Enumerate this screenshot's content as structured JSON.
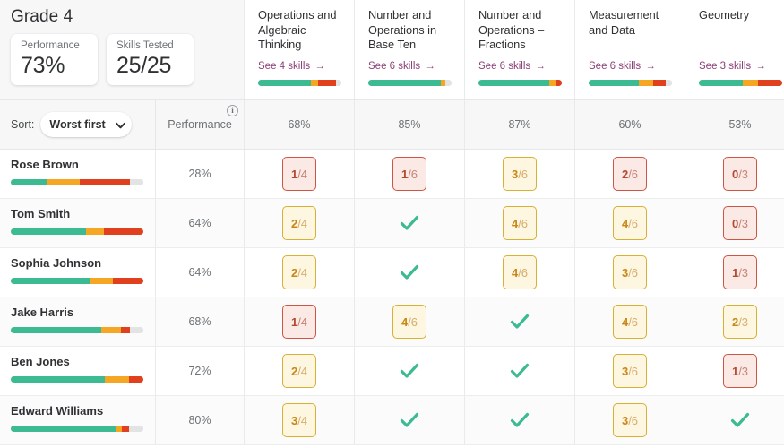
{
  "header": {
    "grade_title": "Grade 4",
    "cards": [
      {
        "label": "Performance",
        "value": "73%"
      },
      {
        "label": "Skills Tested",
        "value": "25/25"
      }
    ]
  },
  "sort": {
    "label": "Sort:",
    "value": "Worst first",
    "chevron_icon": "chevron-down-icon"
  },
  "performance_column": {
    "label": "Performance",
    "info_icon": "info-icon",
    "info_glyph": "i"
  },
  "colors": {
    "green": "#3cba92",
    "orange": "#f5a623",
    "red": "#e0401d",
    "grey": "#e2e3e4",
    "link": "#8c3f77",
    "check": "#3cba92"
  },
  "subjects": [
    {
      "title": "Operations and Algebraic Thinking",
      "link": "See 4 skills",
      "arrow": "→",
      "percent": "68%",
      "bar": {
        "green": 63,
        "orange": 9,
        "red": 22,
        "grey": 6
      }
    },
    {
      "title": "Number and Operations in Base Ten",
      "link": "See 6 skills",
      "arrow": "→",
      "percent": "85%",
      "bar": {
        "green": 87,
        "orange": 6,
        "red": 0,
        "grey": 7
      }
    },
    {
      "title": "Number and Operations – Fractions",
      "link": "See 6 skills",
      "arrow": "→",
      "percent": "87%",
      "bar": {
        "green": 85,
        "orange": 8,
        "red": 7,
        "grey": 0
      }
    },
    {
      "title": "Measurement and Data",
      "link": "See 6 skills",
      "arrow": "→",
      "percent": "60%",
      "bar": {
        "green": 60,
        "orange": 17,
        "red": 16,
        "grey": 7
      }
    },
    {
      "title": "Geometry",
      "link": "See 3 skills",
      "arrow": "→",
      "percent": "53%",
      "bar": {
        "green": 53,
        "orange": 18,
        "red": 29,
        "grey": 0
      }
    }
  ],
  "students": [
    {
      "name": "Rose Brown",
      "performance": "28%",
      "bar": {
        "green": 28,
        "orange": 24,
        "red": 38,
        "grey": 10
      },
      "scores": [
        {
          "type": "box",
          "level": "red",
          "num": "1",
          "den": "/4"
        },
        {
          "type": "box",
          "level": "red",
          "num": "1",
          "den": "/6"
        },
        {
          "type": "box",
          "level": "amber",
          "num": "3",
          "den": "/6"
        },
        {
          "type": "box",
          "level": "red",
          "num": "2",
          "den": "/6"
        },
        {
          "type": "box",
          "level": "red",
          "num": "0",
          "den": "/3"
        }
      ]
    },
    {
      "name": "Tom Smith",
      "performance": "64%",
      "bar": {
        "green": 57,
        "orange": 13,
        "red": 30,
        "grey": 0
      },
      "scores": [
        {
          "type": "box",
          "level": "amber",
          "num": "2",
          "den": "/4"
        },
        {
          "type": "check"
        },
        {
          "type": "box",
          "level": "amber",
          "num": "4",
          "den": "/6"
        },
        {
          "type": "box",
          "level": "amber",
          "num": "4",
          "den": "/6"
        },
        {
          "type": "box",
          "level": "red",
          "num": "0",
          "den": "/3"
        }
      ]
    },
    {
      "name": "Sophia Johnson",
      "performance": "64%",
      "bar": {
        "green": 60,
        "orange": 17,
        "red": 23,
        "grey": 0
      },
      "scores": [
        {
          "type": "box",
          "level": "amber",
          "num": "2",
          "den": "/4"
        },
        {
          "type": "check"
        },
        {
          "type": "box",
          "level": "amber",
          "num": "4",
          "den": "/6"
        },
        {
          "type": "box",
          "level": "amber",
          "num": "3",
          "den": "/6"
        },
        {
          "type": "box",
          "level": "red",
          "num": "1",
          "den": "/3"
        }
      ]
    },
    {
      "name": "Jake Harris",
      "performance": "68%",
      "bar": {
        "green": 68,
        "orange": 15,
        "red": 7,
        "grey": 10
      },
      "scores": [
        {
          "type": "box",
          "level": "red",
          "num": "1",
          "den": "/4"
        },
        {
          "type": "box",
          "level": "amber",
          "num": "4",
          "den": "/6"
        },
        {
          "type": "check"
        },
        {
          "type": "box",
          "level": "amber",
          "num": "4",
          "den": "/6"
        },
        {
          "type": "box",
          "level": "amber",
          "num": "2",
          "den": "/3"
        }
      ]
    },
    {
      "name": "Ben Jones",
      "performance": "72%",
      "bar": {
        "green": 71,
        "orange": 18,
        "red": 11,
        "grey": 0
      },
      "scores": [
        {
          "type": "box",
          "level": "amber",
          "num": "2",
          "den": "/4"
        },
        {
          "type": "check"
        },
        {
          "type": "check"
        },
        {
          "type": "box",
          "level": "amber",
          "num": "3",
          "den": "/6"
        },
        {
          "type": "box",
          "level": "red",
          "num": "1",
          "den": "/3"
        }
      ]
    },
    {
      "name": "Edward Williams",
      "performance": "80%",
      "bar": {
        "green": 80,
        "orange": 4,
        "red": 5,
        "grey": 11
      },
      "scores": [
        {
          "type": "box",
          "level": "amber",
          "num": "3",
          "den": "/4"
        },
        {
          "type": "check"
        },
        {
          "type": "check"
        },
        {
          "type": "box",
          "level": "amber",
          "num": "3",
          "den": "/6"
        },
        {
          "type": "check"
        }
      ]
    }
  ]
}
